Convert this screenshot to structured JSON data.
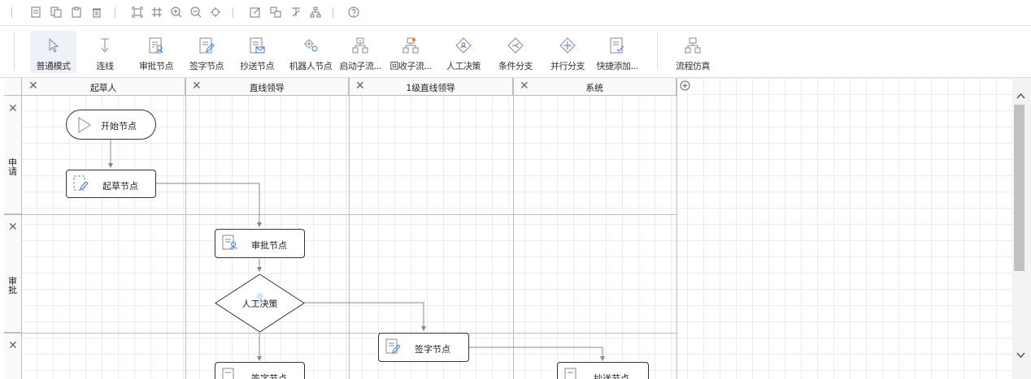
{
  "toolbar": {
    "tools": [
      {
        "label": "普通模式"
      },
      {
        "label": "连线"
      },
      {
        "label": "审批节点"
      },
      {
        "label": "签字节点"
      },
      {
        "label": "抄送节点"
      },
      {
        "label": "机器人节点"
      },
      {
        "label": "启动子流..."
      },
      {
        "label": "回收子流..."
      },
      {
        "label": "人工决策"
      },
      {
        "label": "条件分支"
      },
      {
        "label": "并行分支"
      },
      {
        "label": "快捷添加..."
      },
      {
        "label": "流程仿真"
      }
    ]
  },
  "lanes": {
    "columns": [
      "起草人",
      "直线领导",
      "1级直线领导",
      "系统"
    ],
    "rows": [
      "申请",
      "审批",
      ""
    ]
  },
  "nodes": {
    "start": "开始节点",
    "draft": "起草节点",
    "approve": "审批节点",
    "decision": "人工决策",
    "sign": "签字节点",
    "bottom_left": "签字节点",
    "bottom_right": "抄送节点"
  },
  "colors": {
    "accent": "#3a7bd5",
    "node_border": "#333333",
    "grid": "#ececec"
  }
}
